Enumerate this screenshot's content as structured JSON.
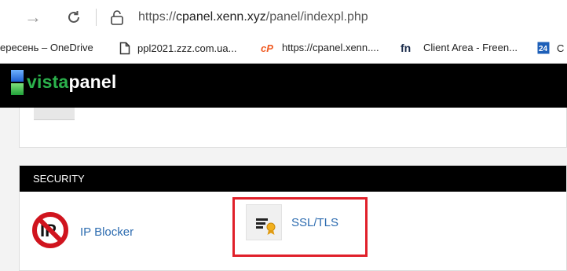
{
  "browser": {
    "url_prefix": "https://",
    "url_domain": "cpanel.xenn.xyz",
    "url_path": "/panel/indexpl.php"
  },
  "bookmarks": [
    {
      "label": "ересень – OneDrive",
      "icon": "none"
    },
    {
      "label": "ppl2021.zzz.com.ua...",
      "icon": "page-icon"
    },
    {
      "label": "https://cpanel.xenn....",
      "icon": "cpanel-icon"
    },
    {
      "label": "Client Area - Freen...",
      "icon": "freenom-icon"
    },
    {
      "label": "C",
      "icon": "calendar-24-icon",
      "icon_text": "24"
    }
  ],
  "brand": {
    "name_part1": "vista",
    "name_part2": "panel",
    "accent": "#2bb24c"
  },
  "security": {
    "header": "SECURITY",
    "items": [
      {
        "label": "IP Blocker",
        "icon": "ip-blocker-icon",
        "icon_text": "IP"
      },
      {
        "label": "SSL/TLS",
        "icon": "ssl-certificate-icon"
      }
    ]
  },
  "colors": {
    "link": "#2d6cb0",
    "highlight": "#e0202a",
    "header_bg": "#000000"
  }
}
